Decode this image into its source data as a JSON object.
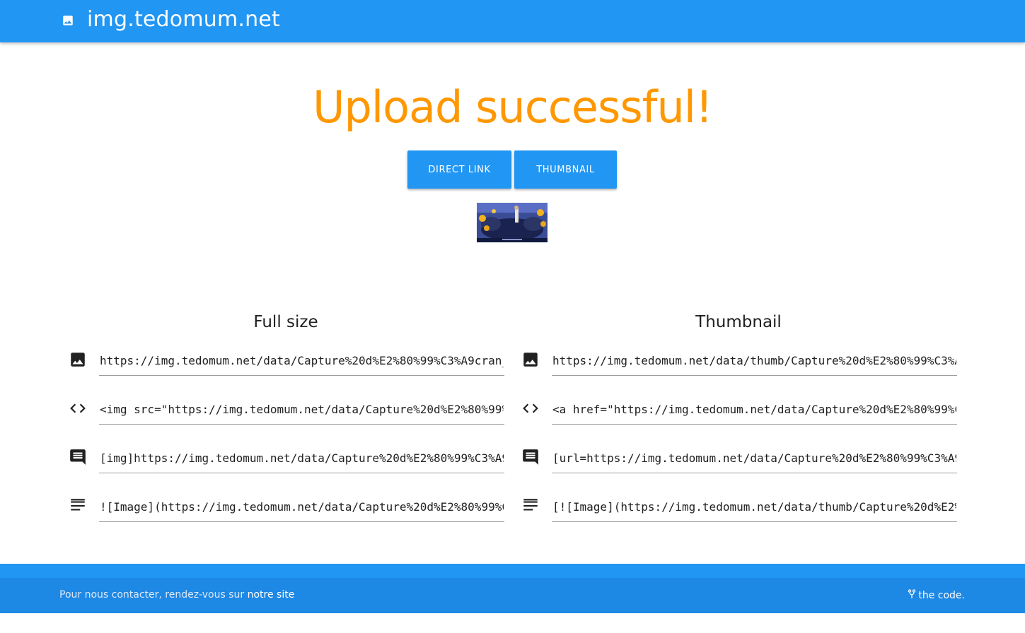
{
  "header": {
    "site_name": "img.tedomum.net",
    "logo_icon": "image-icon"
  },
  "main": {
    "headline": "Upload successful!",
    "buttons": {
      "direct_link": "DIRECT LINK",
      "thumbnail": "THUMBNAIL"
    },
    "preview_icon": "uploaded-image-thumbnail"
  },
  "columns": {
    "full": {
      "title": "Full size",
      "rows": [
        {
          "icon": "image-icon",
          "value": "https://img.tedomum.net/data/Capture%20d%E2%80%99%C3%A9cran_"
        },
        {
          "icon": "code-icon",
          "value": "<img src=\"https://img.tedomum.net/data/Capture%20d%E2%80%99%"
        },
        {
          "icon": "comment-icon",
          "value": "[img]https://img.tedomum.net/data/Capture%20d%E2%80%99%C3%A9"
        },
        {
          "icon": "text-lines-icon",
          "value": "![Image](https://img.tedomum.net/data/Capture%20d%E2%80%99%C"
        }
      ]
    },
    "thumb": {
      "title": "Thumbnail",
      "rows": [
        {
          "icon": "image-icon",
          "value": "https://img.tedomum.net/data/thumb/Capture%20d%E2%80%99%C3%A"
        },
        {
          "icon": "code-icon",
          "value": "<a href=\"https://img.tedomum.net/data/Capture%20d%E2%80%99%C"
        },
        {
          "icon": "comment-icon",
          "value": "[url=https://img.tedomum.net/data/Capture%20d%E2%80%99%C3%A9"
        },
        {
          "icon": "text-lines-icon",
          "value": "[![Image](https://img.tedomum.net/data/thumb/Capture%20d%E2%"
        }
      ]
    }
  },
  "footer": {
    "contact_text": "Pour nous contacter, rendez-vous sur ",
    "contact_link": "notre site",
    "code_link": "the code.",
    "code_icon": "fork-icon"
  },
  "colors": {
    "primary": "#2196f3",
    "accent": "#ff9800",
    "footer": "#1e88e5"
  }
}
